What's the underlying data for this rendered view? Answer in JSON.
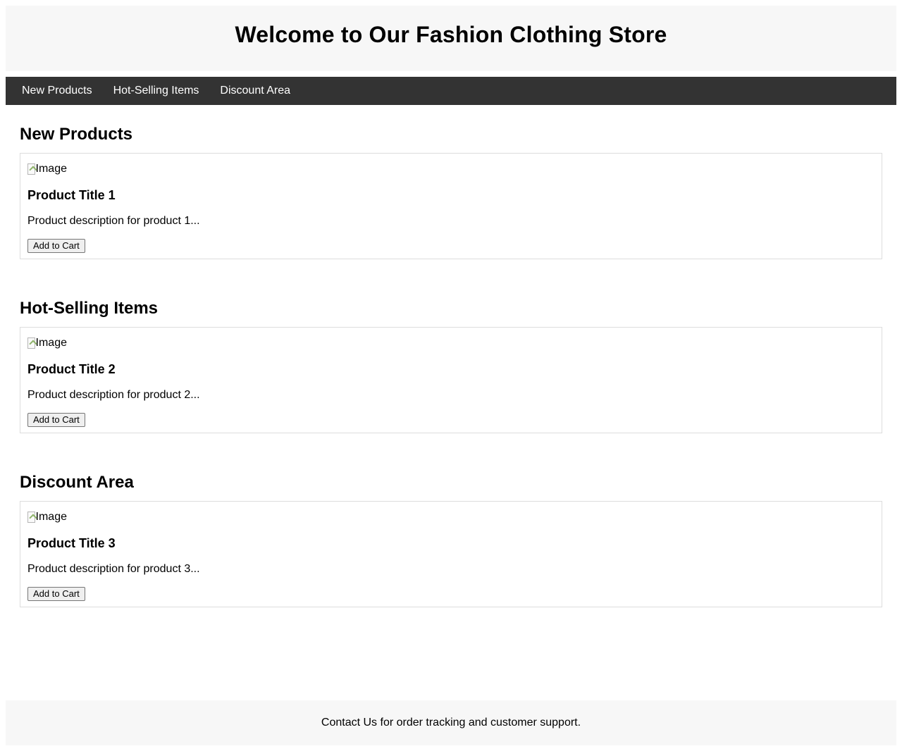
{
  "header": {
    "title": "Welcome to Our Fashion Clothing Store"
  },
  "nav": {
    "items": [
      {
        "label": "New Products"
      },
      {
        "label": "Hot-Selling Items"
      },
      {
        "label": "Discount Area"
      }
    ]
  },
  "sections": [
    {
      "heading": "New Products",
      "product": {
        "image_alt": "Image",
        "title": "Product Title 1",
        "description": "Product description for product 1...",
        "button_label": "Add to Cart"
      }
    },
    {
      "heading": "Hot-Selling Items",
      "product": {
        "image_alt": "Image",
        "title": "Product Title 2",
        "description": "Product description for product 2...",
        "button_label": "Add to Cart"
      }
    },
    {
      "heading": "Discount Area",
      "product": {
        "image_alt": "Image",
        "title": "Product Title 3",
        "description": "Product description for product 3...",
        "button_label": "Add to Cart"
      }
    }
  ],
  "footer": {
    "text": "Contact Us for order tracking and customer support."
  },
  "colors": {
    "header_bg": "#f7f7f7",
    "nav_bg": "#333333",
    "nav_text": "#ffffff",
    "card_border": "#dddddd"
  },
  "icons": {
    "product_image": "broken-image-icon"
  }
}
